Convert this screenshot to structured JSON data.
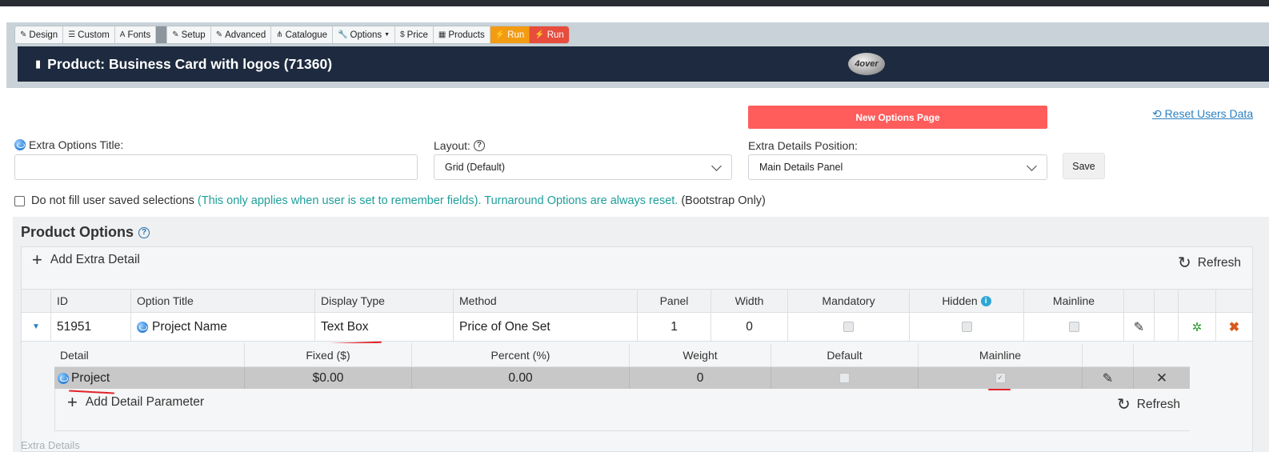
{
  "toolbar": {
    "items": [
      {
        "icon": "pencil-icon",
        "glyph": "✎",
        "label": "Design"
      },
      {
        "icon": "list-icon",
        "glyph": "☰",
        "label": "Custom"
      },
      {
        "icon": "font-icon",
        "glyph": "A",
        "label": "Fonts"
      },
      {
        "icon": "edit-icon",
        "glyph": "✎",
        "label": "Setup"
      },
      {
        "icon": "edit-icon",
        "glyph": "✎",
        "label": "Advanced"
      },
      {
        "icon": "sitemap-icon",
        "glyph": "⋔",
        "label": "Catalogue"
      },
      {
        "icon": "wrench-icon",
        "glyph": "🔧",
        "label": "Options"
      },
      {
        "icon": "dollar-icon",
        "glyph": "$",
        "label": "Price"
      },
      {
        "icon": "table-icon",
        "glyph": "▦",
        "label": "Products"
      },
      {
        "icon": "bolt-icon",
        "glyph": "⚡",
        "label": "Run"
      },
      {
        "icon": "bolt-icon",
        "glyph": "⚡",
        "label": "Run"
      }
    ]
  },
  "product": {
    "title": "Product: Business Card with logos (71360)",
    "logo_text": "4over"
  },
  "actions": {
    "new_options_page": "New Options Page",
    "reset_users_data": "Reset Users Data"
  },
  "form": {
    "extra_options_title_label": "Extra Options Title:",
    "extra_options_title_value": "",
    "layout_label": "Layout:",
    "layout_value": "Grid (Default)",
    "extra_details_position_label": "Extra Details Position:",
    "extra_details_position_value": "Main Details Panel",
    "save_label": "Save",
    "checkbox_label": "Do not fill user saved selections",
    "checkbox_note": "(This only applies when user is set to remember fields). Turnaround Options are always reset.",
    "checkbox_suffix": "(Bootstrap Only)"
  },
  "product_options": {
    "title": "Product Options",
    "add_extra_detail": "Add Extra Detail",
    "refresh": "Refresh",
    "columns": [
      "ID",
      "Option Title",
      "Display Type",
      "Method",
      "Panel",
      "Width",
      "Mandatory",
      "Hidden",
      "Mainline"
    ],
    "row": {
      "id": "51951",
      "option_title": "Project Name",
      "display_type": "Text Box",
      "method": "Price of One Set",
      "panel": "1",
      "width": "0"
    }
  },
  "details": {
    "columns": [
      "Detail",
      "Fixed ($)",
      "Percent (%)",
      "Weight",
      "Default",
      "Mainline"
    ],
    "row": {
      "detail": "Project",
      "fixed": "$0.00",
      "percent": "0.00",
      "weight": "0"
    },
    "add_detail_parameter": "Add Detail Parameter",
    "refresh": "Refresh"
  },
  "footer": {
    "extra_details": "Extra Details"
  },
  "colors": {
    "accent_red": "#ff5c5c",
    "header_navy": "#1d2a3f",
    "teal_note": "#1e9e9a",
    "run_orange": "#f39c12",
    "run_red": "#e74c3c"
  }
}
